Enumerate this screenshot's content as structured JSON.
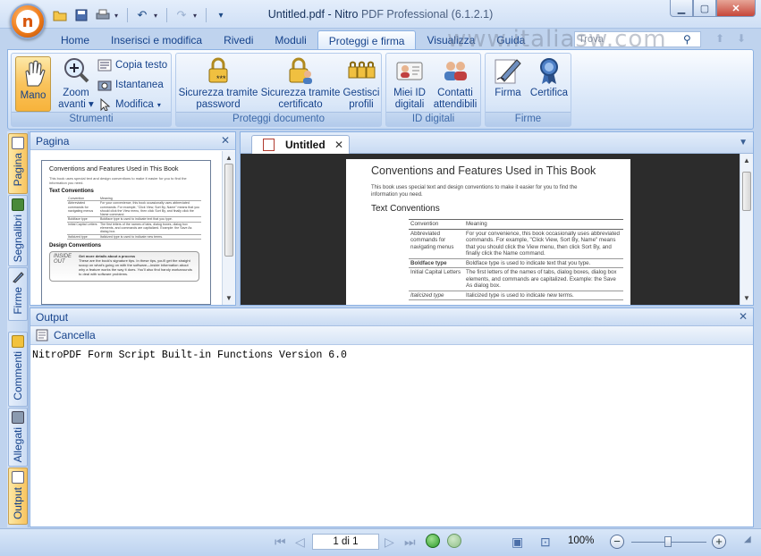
{
  "window": {
    "title": "Untitled.pdf - Nitro",
    "product": "PDF Professional (6.1.2.1)",
    "watermark": "www.italiasw.com"
  },
  "quick_access": [
    "open-folder-icon",
    "save-icon",
    "print-icon",
    "undo-icon",
    "redo-icon",
    "customize-icon"
  ],
  "tabs": [
    {
      "label": "Home"
    },
    {
      "label": "Inserisci e modifica"
    },
    {
      "label": "Rivedi"
    },
    {
      "label": "Moduli"
    },
    {
      "label": "Proteggi e firma",
      "active": true
    },
    {
      "label": "Visualizza"
    },
    {
      "label": "Guida"
    }
  ],
  "search": {
    "placeholder": "Trova"
  },
  "ribbon": {
    "strumenti": {
      "label": "Strumenti",
      "mano": "Mano",
      "zoom": "Zoom",
      "zoom2": "avanti",
      "copia_testo": "Copia testo",
      "istantanea": "Istantanea",
      "modifica": "Modifica"
    },
    "proteggi": {
      "label": "Proteggi documento",
      "sic_pwd_1": "Sicurezza tramite",
      "sic_pwd_2": "password",
      "sic_cert_1": "Sicurezza tramite",
      "sic_cert_2": "certificato",
      "gestisci_1": "Gestisci",
      "gestisci_2": "profili"
    },
    "id_digitali": {
      "label": "ID digitali",
      "miei_1": "Miei ID",
      "miei_2": "digitali",
      "contatti_1": "Contatti",
      "contatti_2": "attendibili"
    },
    "firme": {
      "label": "Firme",
      "firma": "Firma",
      "certifica": "Certifica"
    }
  },
  "sidebar": {
    "tabs": [
      {
        "label": "Pagina",
        "active": true
      },
      {
        "label": "Segnalibri"
      },
      {
        "label": "Firme"
      },
      {
        "label": "Commenti"
      },
      {
        "label": "Allegati"
      },
      {
        "label": "Output"
      }
    ]
  },
  "page_panel": {
    "title": "Pagina"
  },
  "document": {
    "tab_label": "Untitled",
    "heading": "Conventions and Features Used in This Book",
    "intro": "This book uses special text and design conventions to make it easier for you to find the information you need.",
    "section": "Text Conventions",
    "table_header": [
      "Convention",
      "Meaning"
    ],
    "rows": [
      [
        "Abbreviated commands for navigating menus",
        "For your convenience, this book occasionally uses abbreviated commands. For example, \"Click View, Sort By, Name\" means that you should click the View menu, then click Sort By, and finally click the Name command."
      ],
      [
        "Boldface type",
        "Boldface type is used to indicate text that you type."
      ],
      [
        "Initial Capital Letters",
        "The first letters of the names of tabs, dialog boxes, dialog box elements, and commands are capitalized. Example: the Save As dialog box."
      ],
      [
        "Italicized type",
        "Italicized type is used to indicate new terms."
      ]
    ],
    "design_heading": "Design Conventions",
    "inside_out_label": "INSIDE OUT",
    "inside_out_title": "Get more details about a process",
    "inside_out_text": "These are the book's signature tips. In these tips, you'll get the straight scoop on what's going on with the software—inside information about why a feature works the way it does. You'll also find handy workarounds to deal with software problems."
  },
  "output_panel": {
    "title": "Output",
    "clear_label": "Cancella",
    "text": "NitroPDF Form Script Built-in Functions Version 6.0"
  },
  "statusbar": {
    "page": "1 di 1",
    "zoom": "100%"
  },
  "colors": {
    "accent": "#15428b",
    "ribbon_bg": "#dbe8f9",
    "selected": "#f9c35c",
    "doc_bg": "#2c2c2c"
  }
}
